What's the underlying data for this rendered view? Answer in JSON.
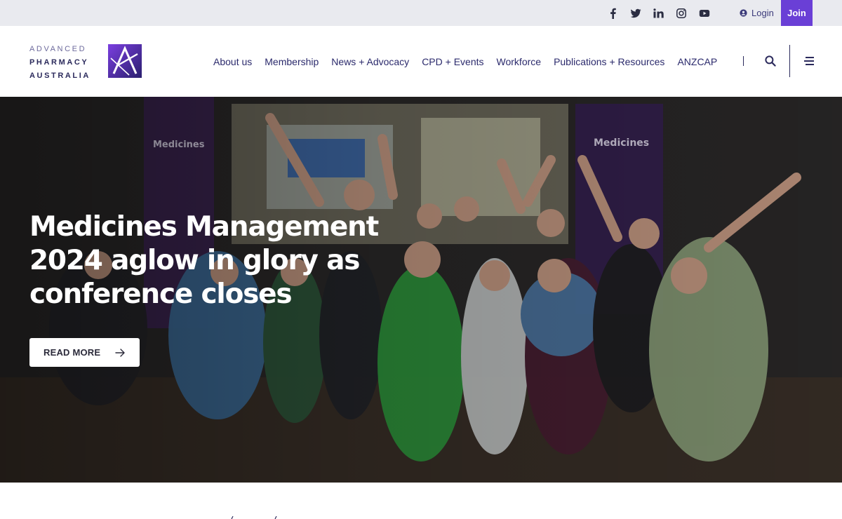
{
  "topbar": {
    "social": [
      {
        "name": "facebook-icon"
      },
      {
        "name": "twitter-icon"
      },
      {
        "name": "linkedin-icon"
      },
      {
        "name": "instagram-icon"
      },
      {
        "name": "youtube-icon"
      }
    ],
    "login_label": "Login",
    "join_label": "Join"
  },
  "header": {
    "logo": {
      "line1": "ADVANCED",
      "line2": "PHARMACY",
      "line3": "AUSTRALIA"
    },
    "nav": [
      {
        "label": "About us"
      },
      {
        "label": "Membership"
      },
      {
        "label": "News + Advocacy"
      },
      {
        "label": "CPD + Events"
      },
      {
        "label": "Workforce"
      },
      {
        "label": "Publications + Resources"
      },
      {
        "label": "ANZCAP"
      }
    ]
  },
  "hero": {
    "title": "Medicines Management 2024 aglow in glory as conference closes",
    "cta_label": "READ MORE"
  },
  "colors": {
    "accent": "#6a3fd6",
    "brand_navy": "#2b2a6c",
    "topbar_bg": "#e9eaef"
  }
}
